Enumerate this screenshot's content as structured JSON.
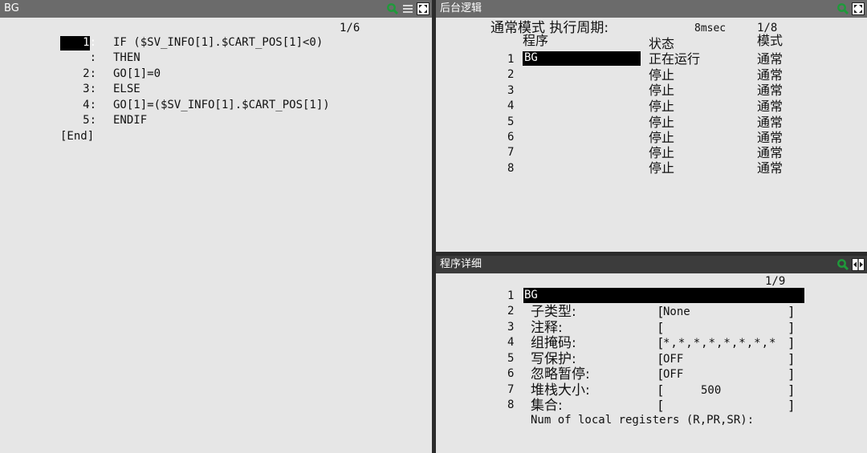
{
  "left_panel": {
    "title": "BG",
    "page_indicator": "1/6",
    "lines": [
      {
        "num": "1:",
        "code": "IF ($SV_INFO[1].$CART_POS[1]<0)"
      },
      {
        "num": ":",
        "code": "THEN"
      },
      {
        "num": "2:",
        "code": "GO[1]=0"
      },
      {
        "num": "3:",
        "code": "ELSE"
      },
      {
        "num": "4:",
        "code": "GO[1]=($SV_INFO[1].$CART_POS[1])"
      },
      {
        "num": "5:",
        "code": "ENDIF"
      }
    ],
    "end_label": "[End]"
  },
  "bg_logic_panel": {
    "title": "后台逻辑",
    "mode_label": "通常模式 执行周期:",
    "cycle_value": "8msec",
    "page_indicator": "1/8",
    "col_program": "程序",
    "col_status": "状态",
    "col_mode": "模式",
    "rows": [
      {
        "num": "1",
        "program": "BG",
        "status": "正在运行",
        "mode": "通常"
      },
      {
        "num": "2",
        "program": "",
        "status": "停止",
        "mode": "通常"
      },
      {
        "num": "3",
        "program": "",
        "status": "停止",
        "mode": "通常"
      },
      {
        "num": "4",
        "program": "",
        "status": "停止",
        "mode": "通常"
      },
      {
        "num": "5",
        "program": "",
        "status": "停止",
        "mode": "通常"
      },
      {
        "num": "6",
        "program": "",
        "status": "停止",
        "mode": "通常"
      },
      {
        "num": "7",
        "program": "",
        "status": "停止",
        "mode": "通常"
      },
      {
        "num": "8",
        "program": "",
        "status": "停止",
        "mode": "通常"
      }
    ]
  },
  "detail_panel": {
    "title": "程序详细",
    "page_indicator": "1/9",
    "program_name": "BG",
    "fields": [
      {
        "num": "2",
        "label": "子类型:",
        "value": "None"
      },
      {
        "num": "3",
        "label": "注释:",
        "value": ""
      },
      {
        "num": "4",
        "label": "组掩码:",
        "value": "*,*,*,*,*,*,*,*"
      },
      {
        "num": "5",
        "label": "写保护:",
        "value": "OFF"
      },
      {
        "num": "6",
        "label": "忽略暂停:",
        "value": "OFF"
      },
      {
        "num": "7",
        "label": "堆栈大小:",
        "value": "500"
      },
      {
        "num": "8",
        "label": "集合:",
        "value": ""
      }
    ],
    "registers_label": "Num of local registers (R,PR,SR):"
  },
  "icons": [
    "zoom-icon",
    "menu-icon",
    "maximize-icon",
    "split-icon"
  ],
  "colors": {
    "panel_bg": "#e6e6e6",
    "title_bar": "#6b6b6b",
    "title_bar_dark": "#3c3c3c",
    "highlight": "#000000",
    "zoom_icon": "#1f9a3a"
  }
}
